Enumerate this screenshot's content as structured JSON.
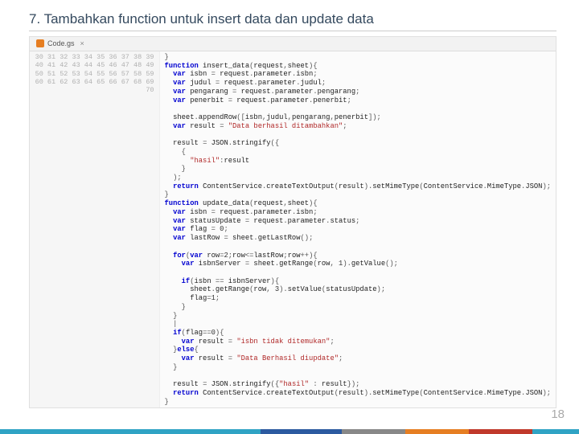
{
  "heading": "7. Tambahkan function untuk insert data dan update data",
  "tab": {
    "name": "Code.gs",
    "close": "×"
  },
  "pagenum": "18",
  "lines_start": 30,
  "code": [
    "}",
    "function insert_data(request,sheet){",
    "  var isbn = request.parameter.isbn;",
    "  var judul = request.parameter.judul;",
    "  var pengarang = request.parameter.pengarang;",
    "  var penerbit = request.parameter.penerbit;",
    "",
    "  sheet.appendRow([isbn,judul,pengarang,penerbit]);",
    "  var result = \"Data berhasil ditambahkan\";",
    "",
    "  result = JSON.stringify({",
    "    {",
    "      \"hasil\":result",
    "    }",
    "  );",
    "  return ContentService.createTextOutput(result).setMimeType(ContentService.MimeType.JSON);",
    "}",
    "function update_data(request,sheet){",
    "  var isbn = request.parameter.isbn;",
    "  var statusUpdate = request.parameter.status;",
    "  var flag = 0;",
    "  var lastRow = sheet.getLastRow();",
    "",
    "  for(var row=2;row<=lastRow;row++){",
    "    var isbnServer = sheet.getRange(row, 1).getValue();",
    "",
    "    if(isbn == isbnServer){",
    "      sheet.getRange(row, 3).setValue(statusUpdate);",
    "      flag=1;",
    "    }",
    "  }",
    "  |",
    "  if(flag==0){",
    "    var result = \"isbn tidak ditemukan\";",
    "  }else{",
    "    var result = \"Data Berhasil diupdate\";",
    "  }",
    "",
    "  result = JSON.stringify({\"hasil\" : result});",
    "  return ContentService.createTextOutput(result).setMimeType(ContentService.MimeType.JSON);",
    "}"
  ]
}
